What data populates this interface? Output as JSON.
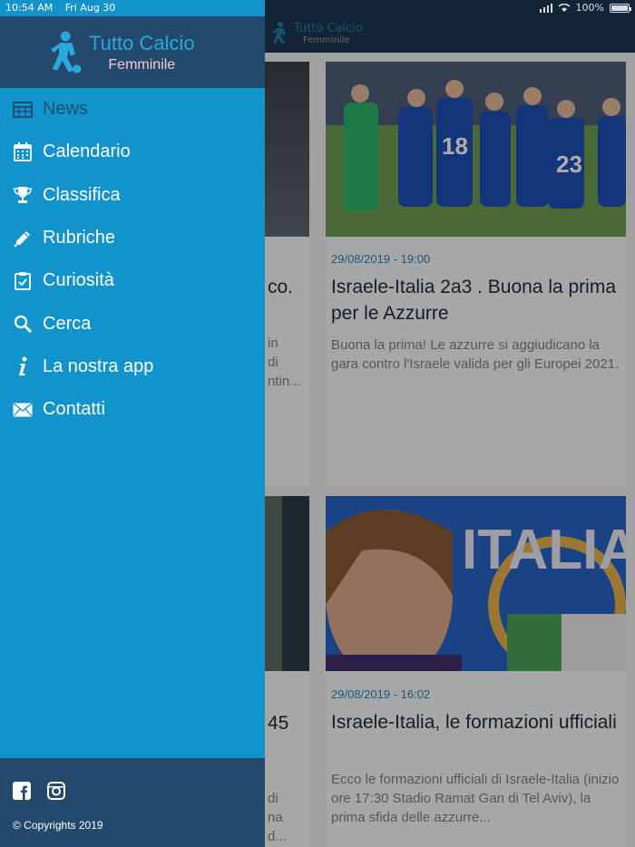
{
  "statusbar": {
    "time": "10:54 AM",
    "date": "Fri Aug 30",
    "battery": "100%"
  },
  "app_header": {
    "brand_line1": "Tutto Calcio",
    "brand_line2": "Femminile"
  },
  "drawer": {
    "brand_line1": "Tutto Calcio",
    "brand_line2": "Femminile",
    "menu": [
      {
        "label": "News",
        "icon": "table-icon",
        "active": true
      },
      {
        "label": "Calendario",
        "icon": "calendar-icon"
      },
      {
        "label": "Classifica",
        "icon": "trophy-icon"
      },
      {
        "label": "Rubriche",
        "icon": "pencil-icon"
      },
      {
        "label": "Curiosità",
        "icon": "clipboard-icon"
      },
      {
        "label": "Cerca",
        "icon": "search-icon"
      },
      {
        "label": "La nostra app",
        "icon": "info-icon"
      },
      {
        "label": "Contatti",
        "icon": "mail-icon"
      }
    ],
    "copyright": "© Copyrights 2019"
  },
  "articles": [
    {
      "partial_title": "co.",
      "partial_excerpt": [
        "in",
        "di",
        "ntin..."
      ]
    },
    {
      "date": "29/08/2019 - 19:00",
      "title": "Israele-Italia 2a3 . Buona la prima per le Azzurre",
      "excerpt": "Buona la prima! Le azzurre si aggiudicano la gara contro l'Israele valida per gli Europei 2021."
    },
    {
      "partial_title": "45",
      "partial_excerpt": [
        "di",
        "na d..."
      ]
    },
    {
      "date": "29/08/2019 - 16:02",
      "title": "Israele-Italia, le formazioni ufficiali",
      "excerpt": "Ecco le formazioni ufficiali di Israele-Italia (inizio ore 17:30 Stadio Ramat Gan di Tel Aviv), la prima sfida delle azzurre..."
    }
  ],
  "colors": {
    "drawer": "#1393cb",
    "header": "#234a6c",
    "navbar": "#1c3550",
    "accent_pink": "#f6c7d9",
    "accent_blue": "#2aa7dd"
  }
}
